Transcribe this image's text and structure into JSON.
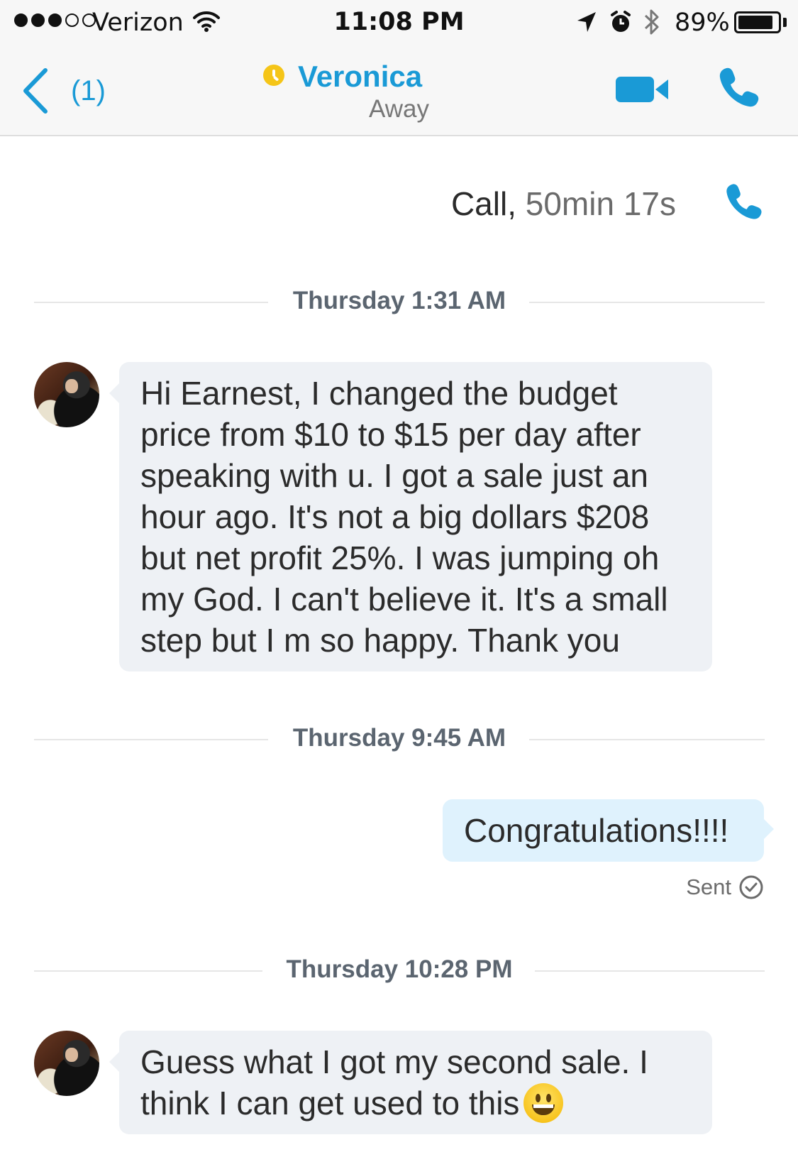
{
  "status_bar": {
    "carrier": "Verizon",
    "time": "11:08 PM",
    "battery_percent": "89%",
    "battery_level": 0.89,
    "signal_bars": 3,
    "icons": [
      "wifi-icon",
      "location-arrow-icon",
      "alarm-icon",
      "bluetooth-icon",
      "battery-icon"
    ]
  },
  "nav": {
    "back_count": "(1)",
    "contact_name": "Veronica",
    "contact_status": "Away",
    "presence_color": "#f5c518",
    "icons": [
      "back-chevron-icon",
      "video-call-icon",
      "phone-icon"
    ]
  },
  "colors": {
    "accent": "#1a9ad6",
    "incoming_bubble": "#eef1f5",
    "outgoing_bubble": "#dff2fd"
  },
  "chat": {
    "call_event": {
      "label": "Call,",
      "duration": "50min 17s"
    },
    "dividers": [
      {
        "label": "Thursday 1:31 AM"
      },
      {
        "label": "Thursday 9:45 AM"
      },
      {
        "label": "Thursday 10:28 PM"
      }
    ],
    "messages": [
      {
        "direction": "incoming",
        "lines": [
          "Hi Earnest, I changed the budget",
          "price from $10 to $15 per day after",
          "speaking with u. I got a sale just an",
          "hour ago. It's not a big dollars $208",
          "but net profit 25%. I was jumping oh",
          "my God. I can't believe it. It's a small",
          "step but I m so happy. Thank you"
        ]
      },
      {
        "direction": "outgoing",
        "text": "Congratulations!!!!",
        "status": "Sent"
      },
      {
        "direction": "incoming",
        "lines": [
          "Guess what I got my second sale. I",
          "think I can get used to this"
        ],
        "emoji": "grinning-face-emoji"
      }
    ]
  }
}
